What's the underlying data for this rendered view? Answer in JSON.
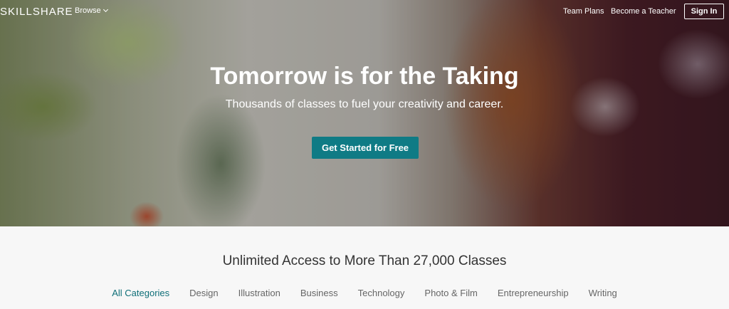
{
  "header": {
    "logo": "SKILLSHARE",
    "browse_label": "Browse",
    "team_plans": "Team Plans",
    "become_teacher": "Become a Teacher",
    "sign_in": "Sign In"
  },
  "hero": {
    "title": "Tomorrow is for the Taking",
    "subtitle": "Thousands of classes to fuel your creativity and career.",
    "cta": "Get Started for Free"
  },
  "categories_section": {
    "title": "Unlimited Access to More Than 27,000 Classes",
    "tabs": [
      {
        "label": "All Categories",
        "active": true
      },
      {
        "label": "Design",
        "active": false
      },
      {
        "label": "Illustration",
        "active": false
      },
      {
        "label": "Business",
        "active": false
      },
      {
        "label": "Technology",
        "active": false
      },
      {
        "label": "Photo & Film",
        "active": false
      },
      {
        "label": "Entrepreneurship",
        "active": false
      },
      {
        "label": "Writing",
        "active": false
      }
    ]
  },
  "colors": {
    "accent": "#0f7b85",
    "active_tab": "#0f6f78"
  }
}
